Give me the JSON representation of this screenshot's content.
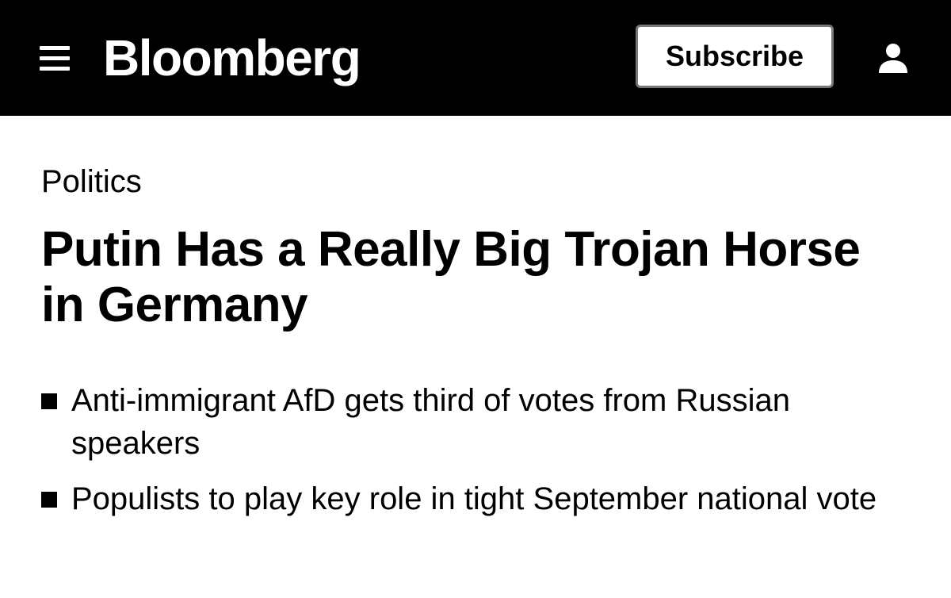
{
  "header": {
    "menu_icon": "hamburger-menu-icon",
    "logo": "Bloomberg",
    "subscribe_label": "Subscribe",
    "account_icon": "user-account-icon",
    "background": "#000000"
  },
  "article": {
    "section": "Politics",
    "headline": "Putin Has a Really Big Trojan Horse in Germany",
    "bullets": [
      "Anti-immigrant AfD gets third of votes from Russian speakers",
      "Populists to play key role in tight September national vote"
    ]
  }
}
